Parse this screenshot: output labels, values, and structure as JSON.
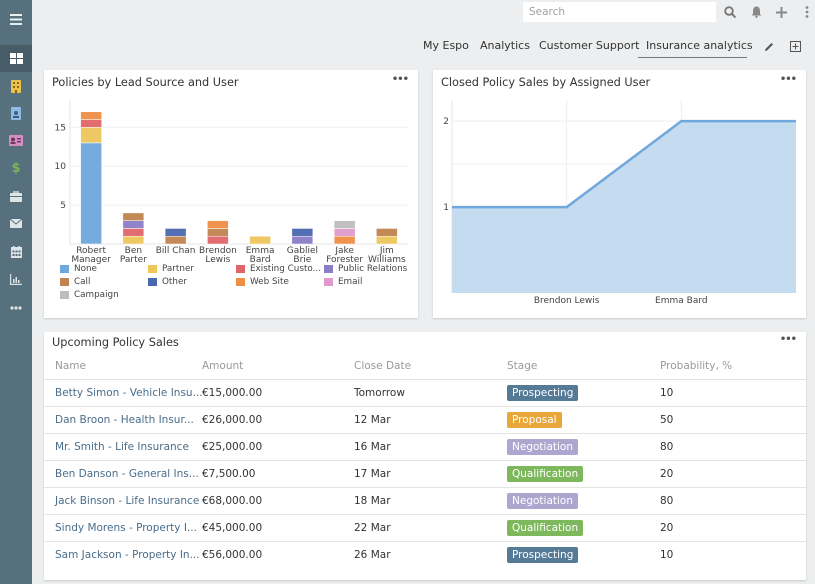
{
  "sidebar": {
    "items": [
      {
        "name": "menu-icon",
        "color": "#e8edf0"
      },
      {
        "name": "dashboard-icon",
        "color": "#ffffff",
        "active": true
      },
      {
        "name": "accounts-icon",
        "color": "#e9c34c"
      },
      {
        "name": "contacts-icon",
        "color": "#8ebbe5"
      },
      {
        "name": "leads-icon",
        "color": "#d58ec4"
      },
      {
        "name": "opportunities-icon",
        "color": "#79b55c"
      },
      {
        "name": "cases-icon",
        "color": "#dfe4e7"
      },
      {
        "name": "email-icon",
        "color": "#dfe4e7"
      },
      {
        "name": "calendar-icon",
        "color": "#dfe4e7"
      },
      {
        "name": "reports-icon",
        "color": "#dfe4e7"
      },
      {
        "name": "more-icon",
        "color": "#dfe4e7"
      }
    ]
  },
  "topbar": {
    "search_placeholder": "Search",
    "icons": [
      "search-icon",
      "bell-icon",
      "plus-icon",
      "kebab-icon"
    ]
  },
  "tabs": [
    {
      "label": "My Espo"
    },
    {
      "label": "Analytics"
    },
    {
      "label": "Customer Support"
    },
    {
      "label": "Insurance analytics",
      "active": true
    }
  ],
  "dashlet_menu": "•••",
  "chart_data": [
    {
      "type": "bar",
      "stacked": true,
      "title": "Policies by Lead Source and User",
      "xlabel": "",
      "ylabel": "",
      "ylim": [
        0,
        18
      ],
      "yticks": [
        5,
        10,
        15
      ],
      "grid": true,
      "legend_position": "bottom",
      "categories": [
        [
          "Robert",
          "Manager"
        ],
        [
          "Ben",
          "Parter"
        ],
        [
          "Bill Chan"
        ],
        [
          "Brendon",
          "Lewis"
        ],
        [
          "Emma",
          "Bard"
        ],
        [
          "Gabliel",
          "Brie"
        ],
        [
          "Jake",
          "Forester"
        ],
        [
          "Jim",
          "Williams"
        ]
      ],
      "series": [
        {
          "name": "None",
          "color": "#6fa8dc",
          "values": [
            13,
            0,
            0,
            0,
            0,
            0,
            0,
            0
          ]
        },
        {
          "name": "Partner",
          "color": "#eec65a",
          "values": [
            2,
            1,
            0,
            0,
            1,
            0,
            0,
            1
          ]
        },
        {
          "name": "Existing Custo...",
          "color": "#e0656a",
          "values": [
            1,
            1,
            0,
            1,
            0,
            0,
            0,
            0
          ]
        },
        {
          "name": "Public Relations",
          "color": "#8b7dc8",
          "values": [
            0,
            1,
            0,
            0,
            0,
            1,
            0,
            0
          ]
        },
        {
          "name": "Call",
          "color": "#c0844f",
          "values": [
            0,
            1,
            1,
            1,
            0,
            0,
            0,
            1
          ]
        },
        {
          "name": "Other",
          "color": "#4a68b0",
          "values": [
            0,
            0,
            1,
            0,
            0,
            1,
            0,
            0
          ]
        },
        {
          "name": "Web Site",
          "color": "#ef8e45",
          "values": [
            1,
            0,
            0,
            1,
            0,
            0,
            1,
            0
          ]
        },
        {
          "name": "Email",
          "color": "#de9bcb",
          "values": [
            0,
            0,
            0,
            0,
            0,
            0,
            1,
            0
          ]
        },
        {
          "name": "Campaign",
          "color": "#bdbdbd",
          "values": [
            0,
            0,
            0,
            0,
            0,
            0,
            1,
            0
          ]
        }
      ]
    },
    {
      "type": "area",
      "title": "Closed Policy Sales by Assigned User",
      "xlabel": "",
      "ylabel": "",
      "ylim": [
        0,
        2.2
      ],
      "yticks": [
        1,
        2
      ],
      "grid": true,
      "categories": [
        "",
        "Brendon Lewis",
        "Emma Bard",
        ""
      ],
      "values": [
        1,
        1,
        2,
        2
      ],
      "line_color": "#6fa8dc",
      "fill_color": "#c5dbef"
    }
  ],
  "upcoming": {
    "title": "Upcoming Policy Sales",
    "columns": [
      "Name",
      "Amount",
      "Close Date",
      "Stage",
      "Probability, %"
    ],
    "rows": [
      {
        "name": "Betty Simon - Vehicle Insu...",
        "amount": "€15,000.00",
        "close": "Tomorrow",
        "stage": "Prospecting",
        "stage_color": "#557a96",
        "prob": "10"
      },
      {
        "name": "Dan Broon - Health Insur...",
        "amount": "€26,000.00",
        "close": "12 Mar",
        "stage": "Proposal",
        "stage_color": "#e8a738",
        "prob": "50"
      },
      {
        "name": "Mr. Smith - Life Insurance",
        "amount": "€25,000.00",
        "close": "16 Mar",
        "stage": "Negotiation",
        "stage_color": "#ada6cf",
        "prob": "80"
      },
      {
        "name": "Ben Danson - General Ins...",
        "amount": "€7,500.00",
        "close": "17 Mar",
        "stage": "Qualification",
        "stage_color": "#7db95c",
        "prob": "20"
      },
      {
        "name": "Jack Binson - Life Insurance",
        "amount": "€68,000.00",
        "close": "18 Mar",
        "stage": "Negotiation",
        "stage_color": "#ada6cf",
        "prob": "80"
      },
      {
        "name": "Sindy Morens - Property I...",
        "amount": "€45,000.00",
        "close": "22 Mar",
        "stage": "Qualification",
        "stage_color": "#7db95c",
        "prob": "20"
      },
      {
        "name": "Sam Jackson - Property In...",
        "amount": "€56,000.00",
        "close": "26 Mar",
        "stage": "Prospecting",
        "stage_color": "#557a96",
        "prob": "10"
      }
    ]
  }
}
